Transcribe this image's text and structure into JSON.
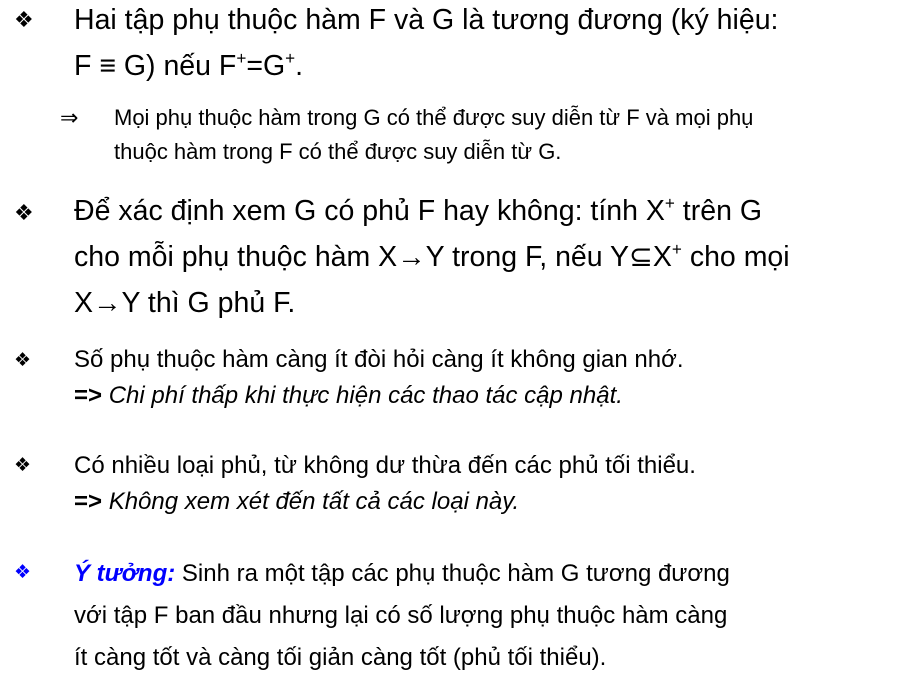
{
  "colors": {
    "text": "#000000",
    "accent": "#0000ff"
  },
  "bullet_icon": "four-diamond-icon",
  "bullet_glyph": "❖",
  "arrow_glyph": "⇒",
  "item1": {
    "line1": "Hai tập phụ thuộc hàm F và G là tương đương (ký hiệu:",
    "line2_a": "F ≡ G) nếu F",
    "plus1": "+",
    "line2_b": "=G",
    "plus2": "+",
    "line2_c": ".",
    "sub": {
      "line1": "Mọi phụ thuộc hàm trong G có thể được suy diễn từ F và mọi phụ",
      "line2": "thuộc hàm trong F có thể được suy diễn từ G."
    }
  },
  "item2": {
    "line1_a": "Để xác định xem G có phủ F hay không: tính X",
    "plus1": "+",
    "line1_b": " trên G",
    "line2_a": "cho mỗi phụ thuộc hàm X→Y trong F, nếu Y⊆X",
    "plus2": "+",
    "line2_b": " cho mọi",
    "line3": "X→Y thì G phủ F."
  },
  "item3": {
    "line1": "Số phụ thuộc hàm càng ít đòi hỏi càng ít không gian nhớ.",
    "prefix": "=> ",
    "line2": "Chi phí thấp khi thực hiện các thao tác cập nhật."
  },
  "item4": {
    "line1": "Có nhiều loại phủ, từ không dư thừa đến các phủ tối thiểu.",
    "prefix": "=> ",
    "line2": "Không xem xét đến tất cả các loại này."
  },
  "item5": {
    "label": "Ý tưởng:",
    "line1": " Sinh ra một tập các phụ thuộc hàm G tương đương",
    "line2": "với tập F ban đầu nhưng lại có số lượng phụ thuộc hàm càng",
    "line3": "ít càng tốt và càng tối giản càng tốt (phủ tối thiểu)."
  }
}
